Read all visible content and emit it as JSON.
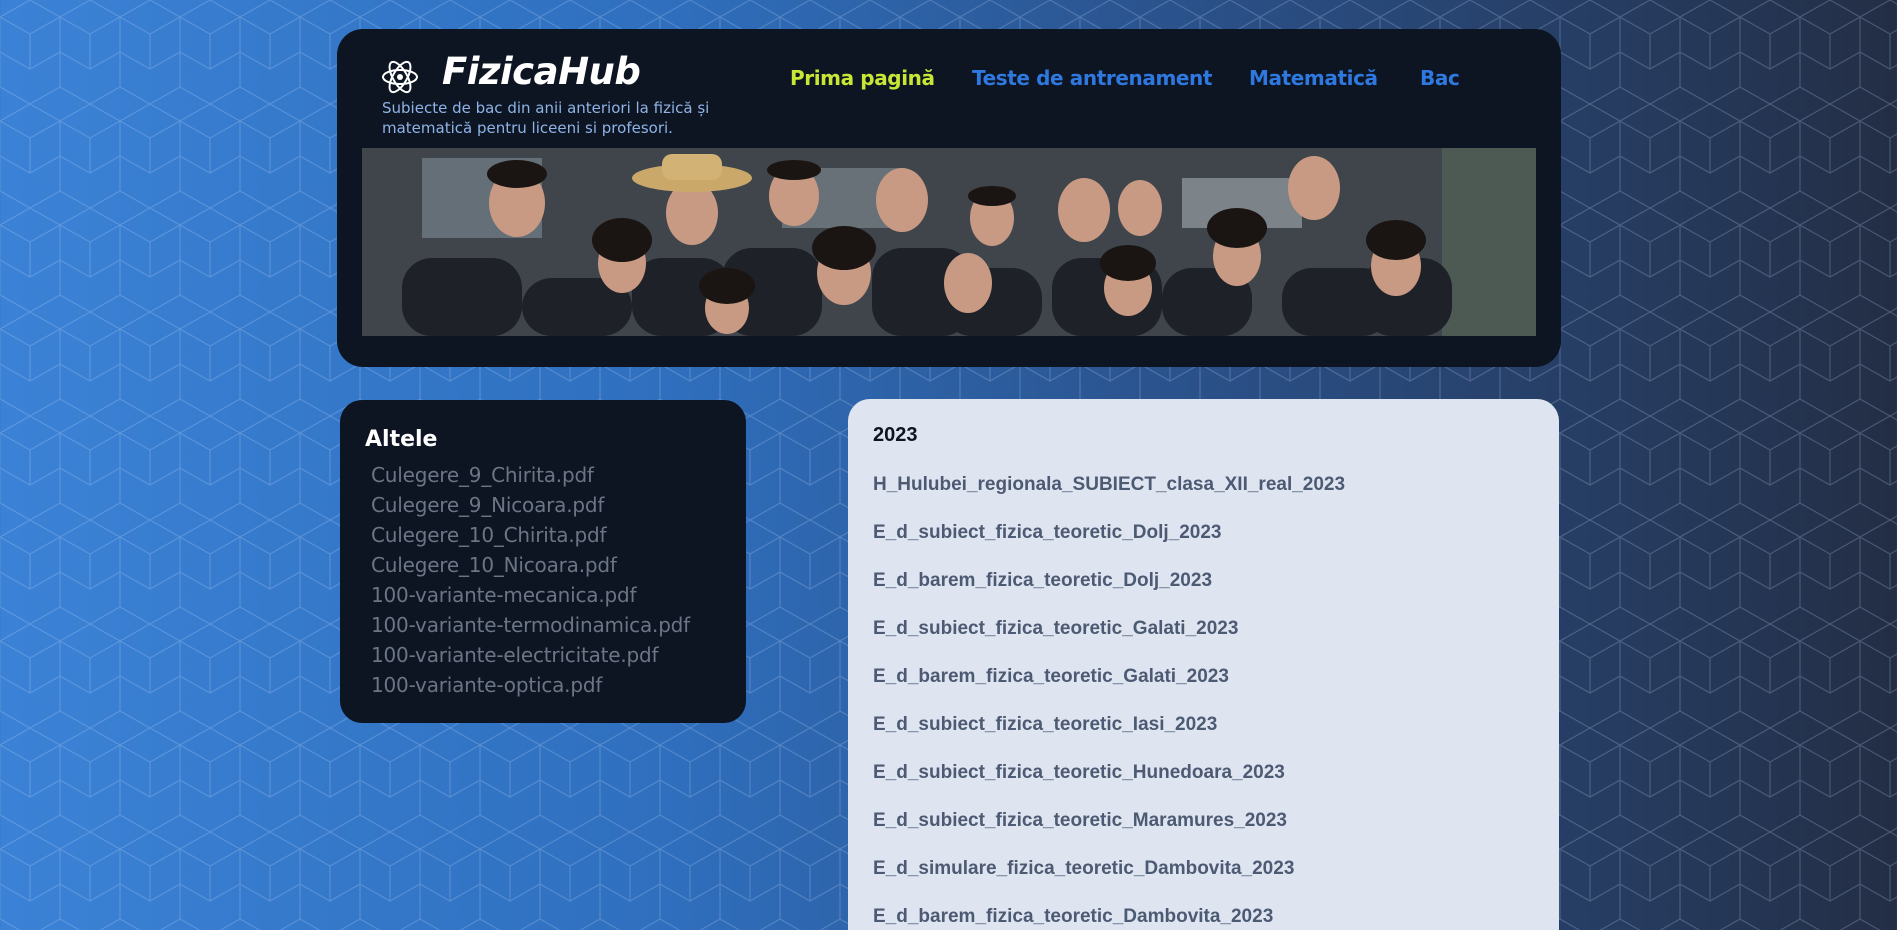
{
  "header": {
    "brand": "FizicaHub",
    "tagline": "Subiecte de bac din anii anteriori la fizică și matematică pentru liceeni si profesori.",
    "logo_icon": "atom-icon",
    "nav": [
      {
        "label": "Prima pagină",
        "active": true
      },
      {
        "label": "Teste de antrenament",
        "active": false
      },
      {
        "label": "Matematică",
        "active": false
      },
      {
        "label": "Bac",
        "active": false
      }
    ],
    "banner": "group-photo"
  },
  "sidebar": {
    "title": "Altele",
    "items": [
      "Culegere_9_Chirita.pdf",
      "Culegere_9_Nicoara.pdf",
      "Culegere_10_Chirita.pdf",
      "Culegere_10_Nicoara.pdf",
      "100-variante-mecanica.pdf",
      "100-variante-termodinamica.pdf",
      "100-variante-electricitate.pdf",
      "100-variante-optica.pdf"
    ]
  },
  "main": {
    "year": "2023",
    "files": [
      "H_Hulubei_regionala_SUBIECT_clasa_XII_real_2023",
      "E_d_subiect_fizica_teoretic_Dolj_2023",
      "E_d_barem_fizica_teoretic_Dolj_2023",
      "E_d_subiect_fizica_teoretic_Galati_2023",
      "E_d_barem_fizica_teoretic_Galati_2023",
      "E_d_subiect_fizica_teoretic_Iasi_2023",
      "E_d_subiect_fizica_teoretic_Hunedoara_2023",
      "E_d_subiect_fizica_teoretic_Maramures_2023",
      "E_d_simulare_fizica_teoretic_Dambovita_2023",
      "E_d_barem_fizica_teoretic_Dambovita_2023"
    ]
  },
  "colors": {
    "nav_active": "#c8e635",
    "nav_link": "#2f78e0",
    "card_dark": "#0d1522",
    "card_light": "#dfe5f0"
  }
}
